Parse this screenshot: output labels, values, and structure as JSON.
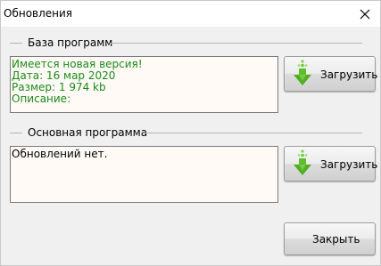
{
  "window": {
    "title": "Обновления",
    "close_glyph": "✕"
  },
  "database_group": {
    "label": "База программ",
    "info_lines": [
      "Имеется новая версия!",
      "Дата: 16 мар 2020",
      "Размер: 1 974 kb",
      "Описание:"
    ],
    "download_label": "Загрузить"
  },
  "program_group": {
    "label": "Основная программа",
    "info_lines": [
      "Обновлений нет."
    ],
    "download_label": "Загрузить"
  },
  "footer": {
    "close_label": "Закрыть"
  },
  "colors": {
    "info_text_green": "#1c8a1c",
    "download_icon_green": "#5fbf2a"
  },
  "icons": {
    "download": "download-arrow-icon",
    "close": "close-icon"
  }
}
